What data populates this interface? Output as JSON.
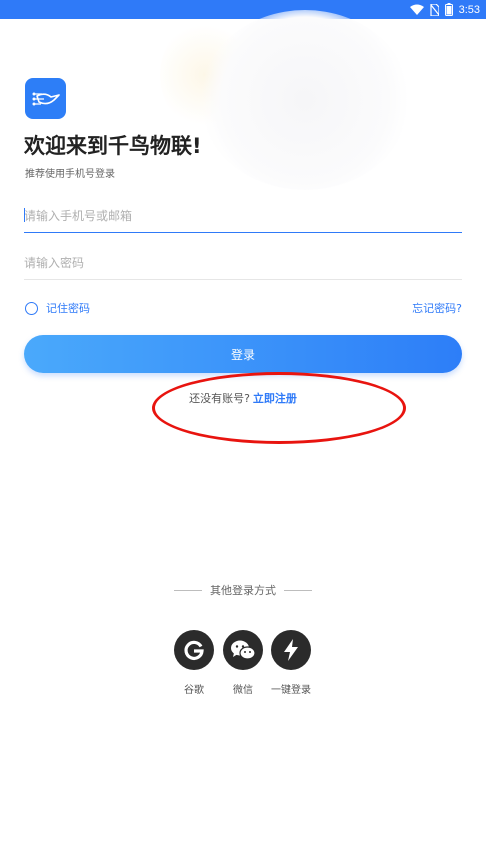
{
  "status_bar": {
    "time": "3:53"
  },
  "welcome": {
    "title": "欢迎来到千鸟物联!",
    "subtitle": "推荐使用手机号登录"
  },
  "form": {
    "account_placeholder": "请输入手机号或邮箱",
    "password_placeholder": "请输入密码",
    "remember_label": "记住密码",
    "forgot_label": "忘记密码?",
    "login_label": "登录"
  },
  "register": {
    "prompt": "还没有账号?",
    "link": "立即注册"
  },
  "other_login": {
    "title": "其他登录方式",
    "options": [
      {
        "label": "谷歌",
        "icon": "google-icon"
      },
      {
        "label": "微信",
        "icon": "wechat-icon"
      },
      {
        "label": "一键登录",
        "icon": "lightning-icon"
      }
    ]
  },
  "colors": {
    "accent": "#2f7af8",
    "annotation": "#e8140f",
    "social_bg": "#2b2b2b"
  }
}
